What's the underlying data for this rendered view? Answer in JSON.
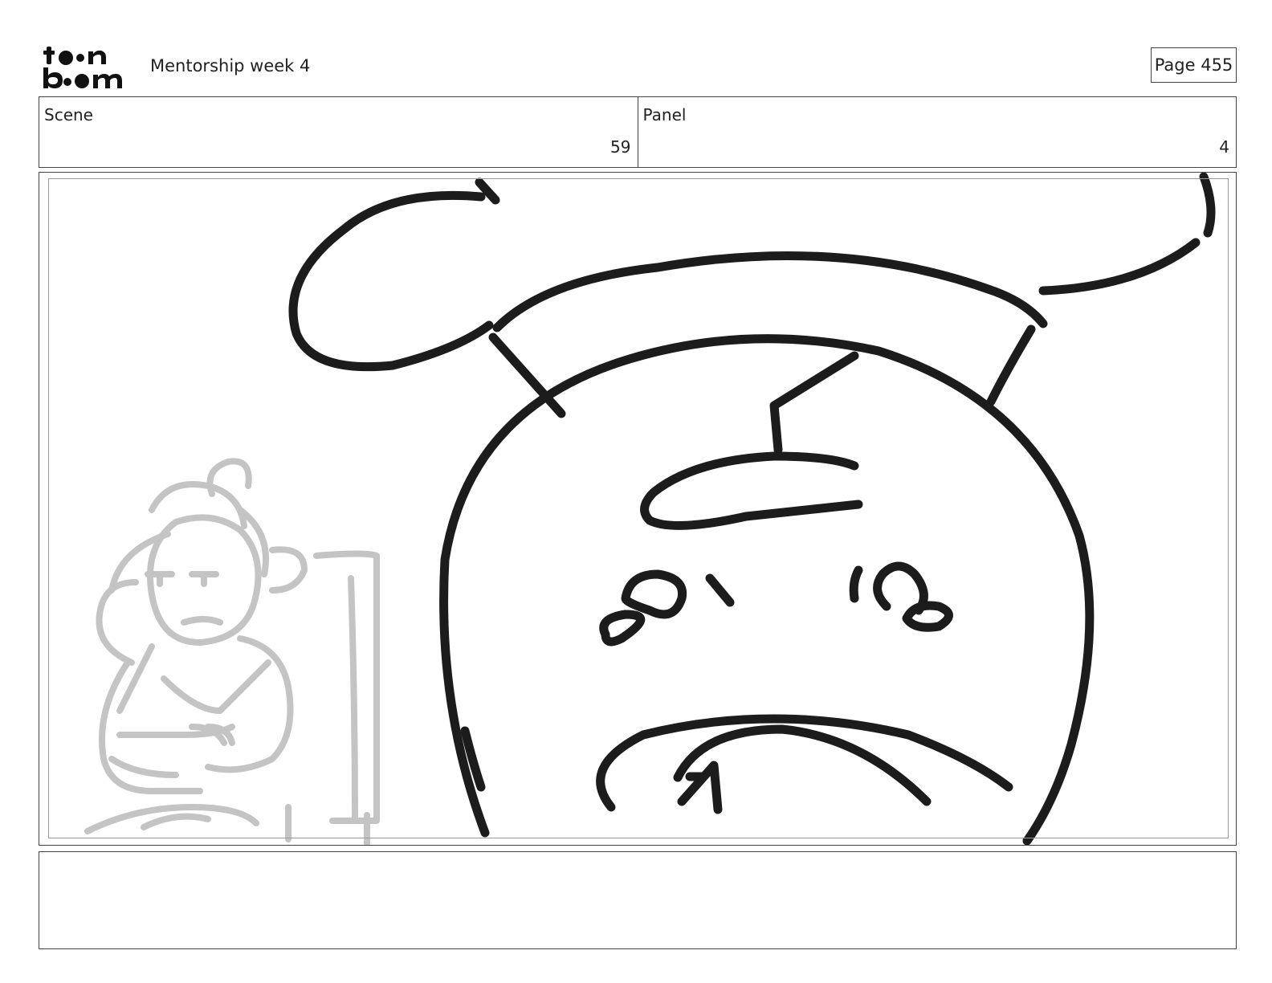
{
  "header": {
    "logo": {
      "line1": "toon",
      "line2": "boom"
    },
    "doc_title": "Mentorship week 4",
    "page_label": "Page 455"
  },
  "meta": {
    "scene_label": "Scene",
    "scene_value": "59",
    "panel_label": "Panel",
    "panel_value": "4"
  },
  "panel": {
    "ink_color": "#1c1c1c",
    "sketch_color": "#c4c4c4"
  },
  "notes": {
    "text": ""
  }
}
